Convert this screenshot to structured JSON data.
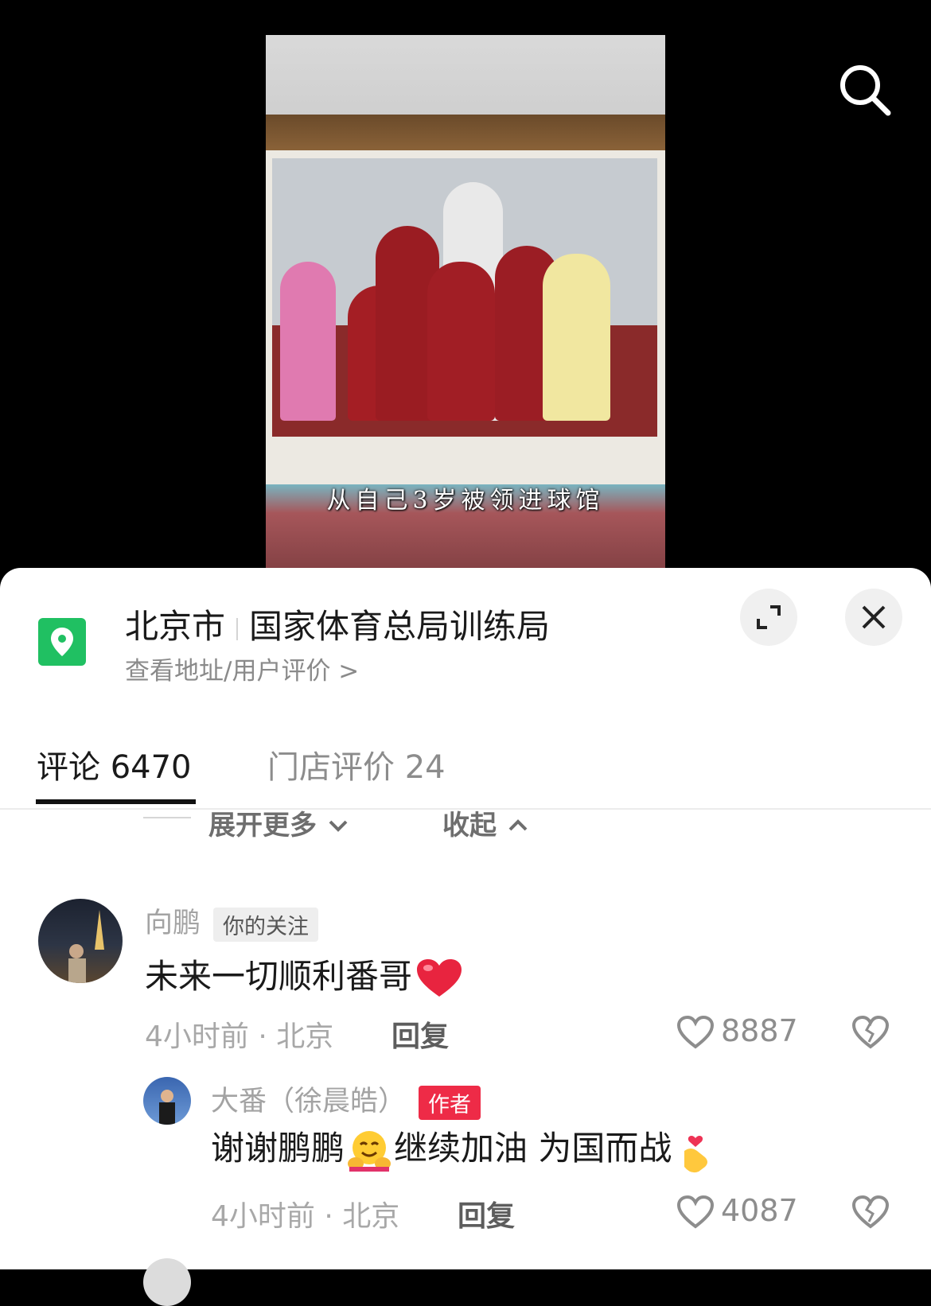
{
  "video": {
    "caption": "从自己3岁被领进球馆"
  },
  "location": {
    "city": "北京市",
    "place": "国家体育总局训练局",
    "subtitle": "查看地址/用户评价 >"
  },
  "tabs": [
    {
      "label": "评论 6470",
      "active": true
    },
    {
      "label": "门店评价 24",
      "active": false
    }
  ],
  "thread_controls": {
    "expand_more": "展开更多",
    "collapse": "收起"
  },
  "comments": [
    {
      "author": "向鹏",
      "badge": "你的关注",
      "text": "未来一切顺利番哥",
      "emoji": "❤️",
      "time_location": "4小时前 · 北京",
      "reply_label": "回复",
      "likes": "8887",
      "replies": [
        {
          "author": "大番（徐晨皓）",
          "badge": "作者",
          "text_part1": "谢谢鹏鹏",
          "emoji1": "🤗",
          "text_part2": "继续加油 为国而战",
          "emoji2": "🫰",
          "time_location": "4小时前 · 北京",
          "reply_label": "回复",
          "likes": "4087"
        }
      ]
    }
  ],
  "colors": {
    "accent_green": "#20c062",
    "author_badge": "#ee2b47",
    "heart_red": "#e8243f"
  }
}
